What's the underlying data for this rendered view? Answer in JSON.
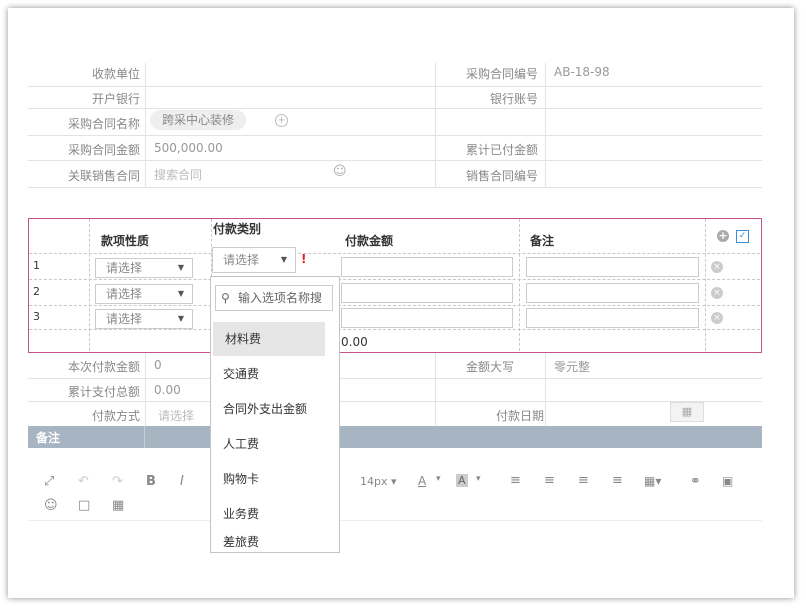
{
  "form": {
    "payee_label": "收款单位",
    "bank_label": "开户银行",
    "contract_name_label": "采购合同名称",
    "contract_name_value": "跨采中心装修",
    "contract_amount_label": "采购合同金额",
    "contract_amount_value": "500,000.00",
    "related_sales_label": "关联销售合同",
    "related_sales_placeholder": "搜索合同",
    "contract_no_label": "采购合同编号",
    "contract_no_value": "AB-18-98",
    "account_label": "银行账号",
    "cumulative_paid_label": "累计已付金额",
    "sales_contract_no_label": "销售合同编号"
  },
  "detail_table": {
    "col_nature": "款项性质",
    "col_category": "付款类别",
    "col_amount": "付款金额",
    "col_remark": "备注",
    "select_placeholder": "请选择",
    "category_placeholder": "请选择",
    "required_mark": "!",
    "rows": [
      "1",
      "2",
      "3"
    ],
    "total_amount": "0.00"
  },
  "dropdown": {
    "search_placeholder": "输入选项名称搜",
    "options": [
      "材料费",
      "交通费",
      "合同外支出金额",
      "人工费",
      "购物卡",
      "业务费",
      "差旅费"
    ]
  },
  "summary": {
    "this_payment_label": "本次付款金额",
    "this_payment_value": "0",
    "cumulative_label": "累计支付总额",
    "cumulative_value": "0.00",
    "method_label": "付款方式",
    "method_placeholder": "请选择",
    "amount_upper_label": "金额大写",
    "amount_upper_value": "零元整",
    "date_label": "付款日期"
  },
  "remark_section": {
    "title": "备注"
  },
  "toolbar": {
    "font_size": "14px",
    "font_color_label": "A",
    "bg_color_label": "A",
    "bold_label": "B",
    "italic_label": "I"
  },
  "icons": {
    "fullscreen": "fullscreen-icon",
    "undo": "undo-icon",
    "redo": "redo-icon",
    "align_left": "align-left-icon",
    "align_center": "align-center-icon",
    "align_right": "align-right-icon",
    "justify": "justify-icon",
    "table": "table-icon",
    "link": "link-icon",
    "image": "image-icon",
    "emoji": "emoji-icon",
    "comment": "comment-icon",
    "media": "media-icon"
  },
  "colors": {
    "highlight_border": "#c9528a",
    "section_bar": "#a7b4c2",
    "required": "#e02020",
    "edit_icon": "#3b8fd6"
  }
}
